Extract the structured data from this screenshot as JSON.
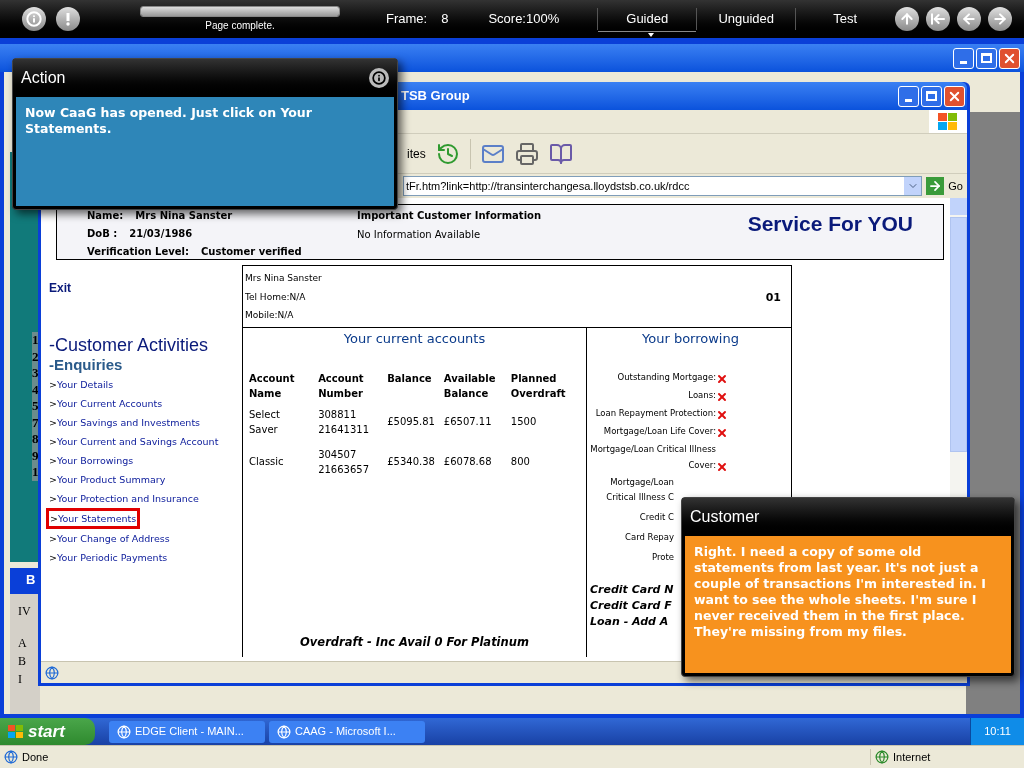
{
  "top_bar": {
    "progress": {
      "level": 1,
      "label": "Page complete."
    },
    "frame_label": "Frame:",
    "frame": "8",
    "score": "Score:100%",
    "modes": [
      {
        "label": "Guided",
        "selected": true
      },
      {
        "label": "Unguided",
        "selected": false
      },
      {
        "label": "Test",
        "selected": false
      }
    ]
  },
  "edge_window": {
    "row_numbers": [
      "1",
      "2",
      "3",
      "4",
      "5",
      "7",
      "8",
      "9",
      "1"
    ],
    "sub_window": {
      "title": "B",
      "lines": [
        "IV",
        "A",
        "B",
        "I"
      ]
    }
  },
  "browser": {
    "title": "TSB Group",
    "toolbar_label": "ites",
    "address": "tFr.htm?link=http://transinterchangesa.lloydstsb.co.uk/rdcc",
    "go": "Go"
  },
  "page": {
    "header": {
      "fields": [
        {
          "label": "Name:",
          "value": "Mrs Nina Sanster"
        },
        {
          "label": "DoB :",
          "value": "21/03/1986"
        },
        {
          "label": "Verification Level:",
          "value": "Customer verified"
        }
      ],
      "info_title": "Important Customer Information",
      "info_text": "No Information Available",
      "slogan": "Service For YOU"
    },
    "nav": {
      "exit": "Exit",
      "section": "-Customer Activities",
      "subsection": "-Enquiries",
      "items": [
        {
          "marker": ">",
          "label": "Your Details",
          "selected": false
        },
        {
          "marker": ">",
          "label": "Your Current Accounts",
          "selected": false
        },
        {
          "marker": ">",
          "label": "Your Savings and Investments",
          "selected": false
        },
        {
          "marker": ">",
          "label": "Your Current and Savings Account",
          "selected": false
        },
        {
          "marker": ">",
          "label": "Your Borrowings",
          "selected": false
        },
        {
          "marker": ">",
          "label": "Your Product Summary",
          "selected": false
        },
        {
          "marker": ">",
          "label": "Your Protection and Insurance",
          "selected": false
        },
        {
          "marker": ">",
          "label": "Your Statements",
          "selected": true
        },
        {
          "marker": ">",
          "label": "Your Change of Address",
          "selected": false
        },
        {
          "marker": ">",
          "label": "Your Periodic Payments",
          "selected": false
        }
      ]
    },
    "customer_box": {
      "lines": [
        "Mrs Nina Sanster",
        "Tel Home:N/A",
        "Mobile:N/A"
      ],
      "code": "01"
    },
    "accounts": {
      "title": "Your current accounts",
      "columns": [
        "Account Name",
        "Account Number",
        "Balance",
        "Available Balance",
        "Planned Overdraft"
      ],
      "rows": [
        [
          "Select Saver",
          "308811 21641311",
          "£5095.81",
          "£6507.11",
          "1500"
        ],
        [
          "Classic",
          "304507 21663657",
          "£5340.38",
          "£6078.68",
          "800"
        ]
      ],
      "footer": "Overdraft - Inc Avail 0 For Platinum"
    },
    "borrowing": {
      "title": "Your borrowing",
      "items": [
        {
          "label": "Outstanding Mortgage:",
          "held": false
        },
        {
          "label": "Loans:",
          "held": false
        },
        {
          "label": "Loan Repayment Protection:",
          "held": false
        },
        {
          "label": "Mortgage/Loan Life Cover:",
          "held": false
        },
        {
          "label": "Mortgage/Loan Critical Illness Cover:",
          "held": false
        }
      ],
      "cut_items": [
        "Mortgage/Loan Critical Illness C",
        "Credit C",
        "Card Repay",
        "Prote"
      ],
      "products": [
        "Credit Card N",
        "Credit Card F",
        "Loan - Add A"
      ]
    }
  },
  "action_popup": {
    "title": "Action",
    "text": "Now CaaG has opened. Just click on Your Statements."
  },
  "customer_popup": {
    "title": "Customer",
    "text": "Right. I need a copy of some old statements from last year. It's not just a couple of transactions I'm interested in. I want to see the whole sheets. I'm sure I never received them in the first place. They're missing from my files."
  },
  "taskbar": {
    "start": "start",
    "tasks": [
      "EDGE Client - MAIN...",
      "CAAG - Microsoft I..."
    ],
    "clock": "10:11"
  },
  "status_bar": {
    "text": "Done",
    "zone": "Internet"
  }
}
